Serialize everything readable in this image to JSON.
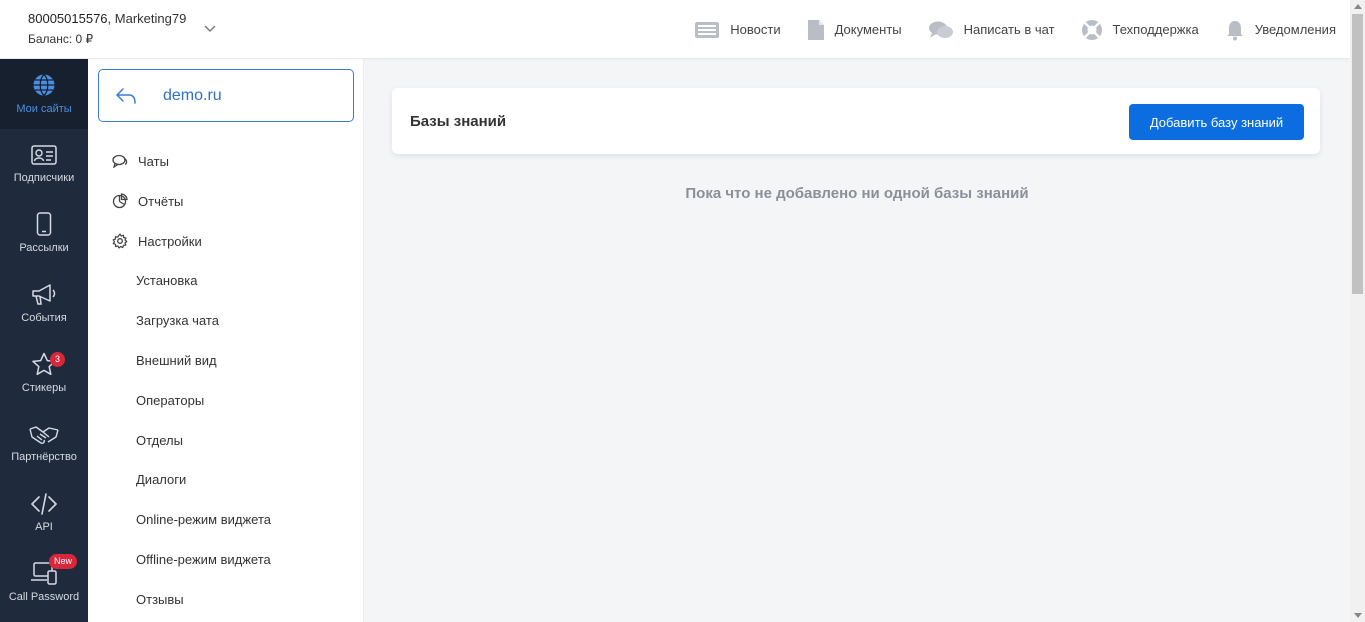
{
  "header": {
    "account_id": "80005015576",
    "account_name": ", Marketing79",
    "balance": "Баланс: 0 ₽",
    "nav": [
      {
        "label": "Новости",
        "icon": "news-icon"
      },
      {
        "label": "Документы",
        "icon": "document-icon"
      },
      {
        "label": "Написать в чат",
        "icon": "chat-icon"
      },
      {
        "label": "Техподдержка",
        "icon": "lifebuoy-icon"
      },
      {
        "label": "Уведомления",
        "icon": "bell-icon"
      }
    ]
  },
  "rail": {
    "items": [
      {
        "label": "Мои сайты",
        "icon": "globe-icon",
        "active": true
      },
      {
        "label": "Подписчики",
        "icon": "contact-card-icon"
      },
      {
        "label": "Рассылки",
        "icon": "phone-icon"
      },
      {
        "label": "События",
        "icon": "megaphone-icon"
      },
      {
        "label": "Стикеры",
        "icon": "star-icon",
        "badge": "3"
      },
      {
        "label": "Партнёрство",
        "icon": "handshake-icon"
      },
      {
        "label": "API",
        "icon": "code-icon"
      },
      {
        "label": "Call Password",
        "icon": "laptop-phone-icon",
        "badge": "New"
      }
    ]
  },
  "sidebar": {
    "site": "demo.ru",
    "menu": [
      {
        "label": "Чаты",
        "icon": "chats-icon"
      },
      {
        "label": "Отчёты",
        "icon": "report-icon"
      },
      {
        "label": "Настройки",
        "icon": "gear-icon"
      }
    ],
    "submenu": [
      "Установка",
      "Загрузка чата",
      "Внешний вид",
      "Операторы",
      "Отделы",
      "Диалоги",
      "Online-режим виджета",
      "Offline-режим виджета",
      "Отзывы"
    ]
  },
  "main": {
    "title": "Базы знаний",
    "add_button": "Добавить базу знаний",
    "empty_message": "Пока что не добавлено ни одной базы знаний"
  },
  "colors": {
    "accent": "#0b6de0",
    "rail_bg": "#1f2a3c",
    "rail_active_text": "#4a8fe2",
    "badge": "#d8273b"
  }
}
